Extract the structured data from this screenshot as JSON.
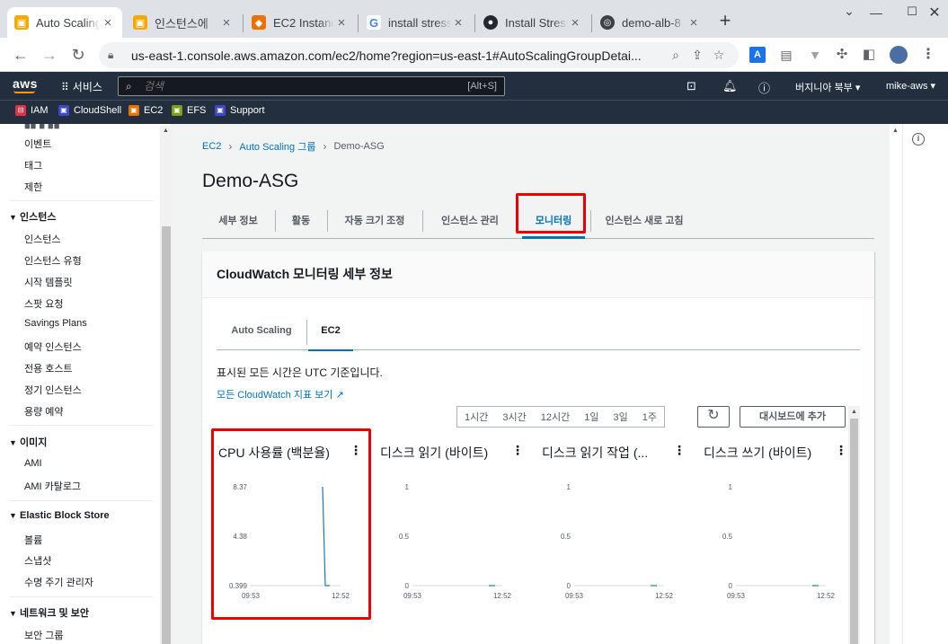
{
  "browser": {
    "tabs": [
      {
        "label": "Auto Scaling",
        "icon": "aws-box-icon",
        "color": "#f7a800"
      },
      {
        "label": "인스턴스에",
        "icon": "aws-box-icon",
        "color": "#f7a800"
      },
      {
        "label": "EC2 Instanc",
        "icon": "ec2-icon",
        "color": "#ed7100"
      },
      {
        "label": "install stress",
        "icon": "google-icon",
        "color": "#4285f4"
      },
      {
        "label": "Install Stress",
        "icon": "github-icon",
        "color": "#24292f"
      },
      {
        "label": "demo-alb-8",
        "icon": "globe-icon",
        "color": "#3c4043"
      }
    ],
    "url": "us-east-1.console.aws.amazon.com/ec2/home?region=us-east-1#AutoScalingGroupDetai..."
  },
  "awsnav": {
    "logo": "aws",
    "services_label": "서비스",
    "search_placeholder": "검색",
    "search_hint": "[Alt+S]",
    "region": "버지니아 북부 ▾",
    "account": "mike-aws ▾"
  },
  "favorites": [
    {
      "label": "IAM",
      "color": "#dd344c"
    },
    {
      "label": "CloudShell",
      "color": "#3f48cc"
    },
    {
      "label": "EC2",
      "color": "#ed7100"
    },
    {
      "label": "EFS",
      "color": "#7aa116"
    },
    {
      "label": "Support",
      "color": "#3f48cc"
    }
  ],
  "sidebar": {
    "top_items": [
      "이벤트",
      "태그",
      "제한"
    ],
    "sections": [
      {
        "title": "인스턴스",
        "items": [
          "인스턴스",
          "인스턴스 유형",
          "시작 템플릿",
          "스팟 요청",
          "Savings Plans",
          "예약 인스턴스",
          "전용 호스트",
          "정기 인스턴스",
          "용량 예약"
        ]
      },
      {
        "title": "이미지",
        "items": [
          "AMI",
          "AMI 카탈로그"
        ]
      },
      {
        "title": "Elastic Block Store",
        "items": [
          "볼륨",
          "스냅샷",
          "수명 주기 관리자"
        ]
      },
      {
        "title": "네트워크 및 보안",
        "items": [
          "보안 그룹"
        ]
      }
    ]
  },
  "breadcrumb": [
    "EC2",
    "Auto Scaling 그룹",
    "Demo-ASG"
  ],
  "page_title": "Demo-ASG",
  "tabs": [
    "세부 정보",
    "활동",
    "자동 크기 조정",
    "인스턴스 관리",
    "모니터링",
    "인스턴스 새로 고침"
  ],
  "active_tab": "모니터링",
  "panel": {
    "title": "CloudWatch 모니터링 세부 정보",
    "subtabs": [
      "Auto Scaling",
      "EC2"
    ],
    "active_subtab": "EC2",
    "tz_note": "표시된 모든 시간은 UTC 기준입니다.",
    "cw_link": "모든 CloudWatch 지표 보기",
    "ranges": [
      "1시간",
      "3시간",
      "12시간",
      "1일",
      "3일",
      "1주"
    ],
    "add_dashboard": "대시보드에 추가"
  },
  "chart_data": [
    {
      "type": "line",
      "title": "CPU 사용률 (백분율)",
      "x": [
        "09:53",
        "12:52"
      ],
      "yticks": [
        "8.37",
        "4.38",
        "0.399"
      ],
      "ylim": [
        0.399,
        8.37
      ],
      "series": [
        {
          "points": [
            [
              0.8,
              8.37
            ],
            [
              0.83,
              0.399
            ],
            [
              0.88,
              0.399
            ]
          ]
        }
      ],
      "color": "#1f77b4"
    },
    {
      "type": "line",
      "title": "디스크 읽기 (바이트)",
      "x": [
        "09:53",
        "12:52"
      ],
      "yticks": [
        "1",
        "0.5",
        "0"
      ],
      "ylim": [
        0,
        1
      ],
      "series": [
        {
          "points": [
            [
              0.85,
              0
            ],
            [
              0.92,
              0
            ]
          ]
        }
      ],
      "color": "#1f77b4"
    },
    {
      "type": "line",
      "title": "디스크 읽기 작업 (...",
      "x": [
        "09:53",
        "12:52"
      ],
      "yticks": [
        "1",
        "0.5",
        "0"
      ],
      "ylim": [
        0,
        1
      ],
      "series": [
        {
          "points": [
            [
              0.85,
              0
            ],
            [
              0.92,
              0
            ]
          ]
        }
      ],
      "color": "#1f77b4"
    },
    {
      "type": "line",
      "title": "디스크 쓰기 (바이트)",
      "x": [
        "09:53",
        "12:52"
      ],
      "yticks": [
        "1",
        "0.5",
        "0"
      ],
      "ylim": [
        0,
        1
      ],
      "series": [
        {
          "points": [
            [
              0.85,
              0
            ],
            [
              0.92,
              0
            ]
          ]
        }
      ],
      "color": "#1f77b4"
    }
  ]
}
